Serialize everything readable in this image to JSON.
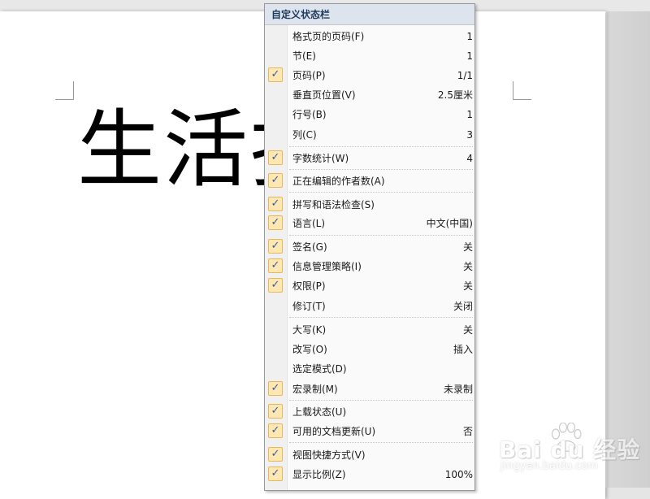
{
  "document": {
    "visible_text": "生活护"
  },
  "menu": {
    "title": "自定义状态栏",
    "items": [
      {
        "label": "格式页的页码(F)",
        "value": "1",
        "checked": false
      },
      {
        "label": "节(E)",
        "value": "1",
        "checked": false
      },
      {
        "label": "页码(P)",
        "value": "1/1",
        "checked": true
      },
      {
        "label": "垂直页位置(V)",
        "value": "2.5厘米",
        "checked": false
      },
      {
        "label": "行号(B)",
        "value": "1",
        "checked": false
      },
      {
        "label": "列(C)",
        "value": "3",
        "checked": false
      },
      {
        "label": "字数统计(W)",
        "value": "4",
        "checked": true
      },
      {
        "label": "正在编辑的作者数(A)",
        "value": "",
        "checked": true
      },
      {
        "label": "拼写和语法检查(S)",
        "value": "",
        "checked": true
      },
      {
        "label": "语言(L)",
        "value": "中文(中国)",
        "checked": true
      },
      {
        "label": "签名(G)",
        "value": "关",
        "checked": true
      },
      {
        "label": "信息管理策略(I)",
        "value": "关",
        "checked": true
      },
      {
        "label": "权限(P)",
        "value": "关",
        "checked": true
      },
      {
        "label": "修订(T)",
        "value": "关闭",
        "checked": false
      },
      {
        "label": "大写(K)",
        "value": "关",
        "checked": false
      },
      {
        "label": "改写(O)",
        "value": "插入",
        "checked": false
      },
      {
        "label": "选定模式(D)",
        "value": "",
        "checked": false
      },
      {
        "label": "宏录制(M)",
        "value": "未录制",
        "checked": true
      },
      {
        "label": "上载状态(U)",
        "value": "",
        "checked": true
      },
      {
        "label": "可用的文档更新(U)",
        "value": "否",
        "checked": true
      },
      {
        "label": "视图快捷方式(V)",
        "value": "",
        "checked": true
      },
      {
        "label": "显示比例(Z)",
        "value": "100%",
        "checked": true
      }
    ],
    "check_glyph": "✓",
    "check_icon": "checkmark-icon"
  },
  "watermark": {
    "main": "Bai du 经验",
    "sub": "jingyan.baidu.com"
  },
  "colors": {
    "menu_title_text": "#1e395b",
    "check_fill": "#fde8b4",
    "check_border": "#e6b85c",
    "check_mark": "#3b5a9a"
  }
}
